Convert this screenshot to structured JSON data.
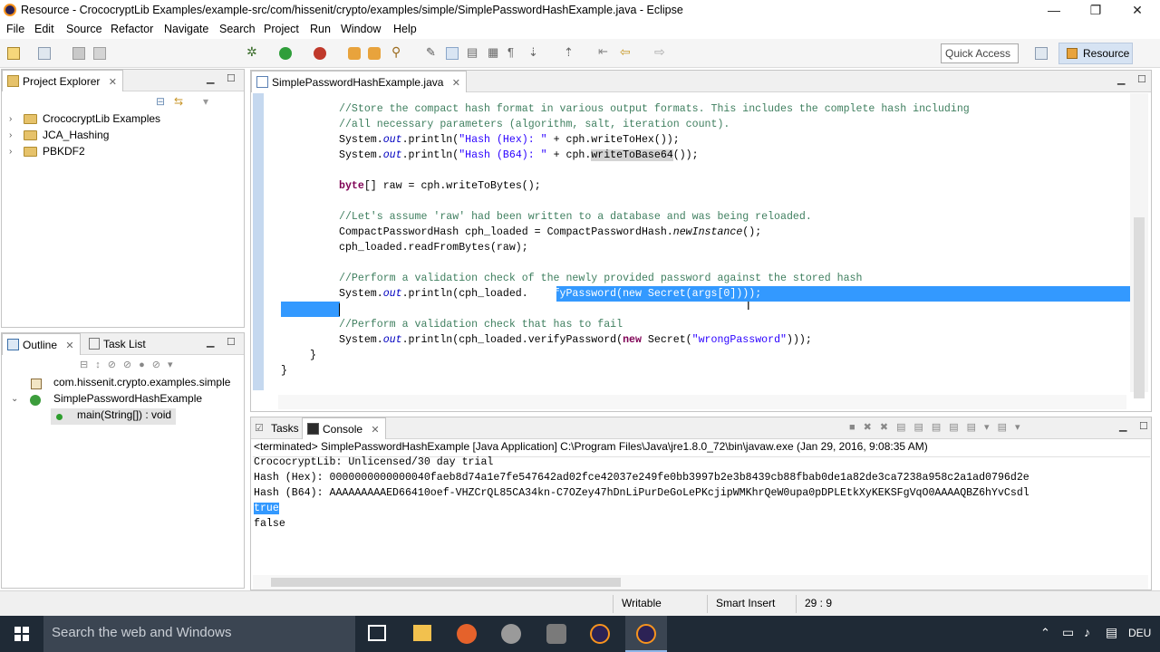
{
  "window": {
    "title": "Resource - CrococryptLib Examples/example-src/com/hissenit/crypto/examples/simple/SimplePasswordHashExample.java - Eclipse",
    "controls": [
      "—",
      "❐",
      "✕"
    ]
  },
  "menu": [
    "File",
    "Edit",
    "Source",
    "Refactor",
    "Navigate",
    "Search",
    "Project",
    "Run",
    "Window",
    "Help"
  ],
  "toolbar": {
    "quick_access": "Quick Access",
    "perspective": "Resource"
  },
  "project_explorer": {
    "tab": "Project Explorer",
    "items": [
      "CrococryptLib Examples",
      "JCA_Hashing",
      "PBKDF2"
    ]
  },
  "outline": {
    "tabs": [
      "Outline",
      "Task List"
    ],
    "package": "com.hissenit.crypto.examples.simple",
    "class": "SimplePasswordHashExample",
    "method": "main(String[]) : void"
  },
  "editor": {
    "tab": "SimplePasswordHashExample.java",
    "lines": [
      "//Store the compact hash format in various output formats. This includes the complete hash including",
      "//all necessary parameters (algorithm, salt, iteration count).",
      "System.out.println(\"Hash (Hex): \" + cph.writeToHex());",
      "System.out.println(\"Hash (B64): \" + cph.writeToBase64());",
      "byte[] raw = cph.writeToBytes();",
      "//Let's assume 'raw' had been written to a database and was being reloaded.",
      "CompactPasswordHash cph_loaded = CompactPasswordHash.newInstance();",
      "cph_loaded.readFromBytes(raw);",
      "//Perform a validation check of the newly provided password against the stored hash",
      "System.out.println(cph_loaded.verifyPassword(new Secret(args[0])));",
      "//Perform a validation check that has to fail",
      "System.out.println(cph_loaded.verifyPassword(new Secret(\"wrongPassword\")));",
      "}",
      "}"
    ]
  },
  "console": {
    "tabs": [
      "Tasks",
      "Console"
    ],
    "header": "<terminated> SimplePasswordHashExample [Java Application] C:\\Program Files\\Java\\jre1.8.0_72\\bin\\javaw.exe (Jan 29, 2016, 9:08:35 AM)",
    "lines": [
      "CrococryptLib: Unlicensed/30 day trial",
      "Hash (Hex): 0000000000000040faeb8d74a1e7fe547642ad02fce42037e249fe0bb3997b2e3b8439cb88fbab0de1a82de3ca7238a958c2a1ad0796d2e",
      "Hash (B64): AAAAAAAAAED66410oef-VHZCrQL85CA34kn-C7OZey47hDnLiPurDeGoLePKcjipWMKhrQeW0upa0pDPLEtkXyKEKSFgVqO0AAAAQBZ6hYvCsdl",
      "true",
      "false"
    ]
  },
  "status": {
    "writable": "Writable",
    "insert": "Smart Insert",
    "position": "29 : 9"
  },
  "taskbar": {
    "search_placeholder": "Search the web and Windows",
    "language": "DEU"
  }
}
